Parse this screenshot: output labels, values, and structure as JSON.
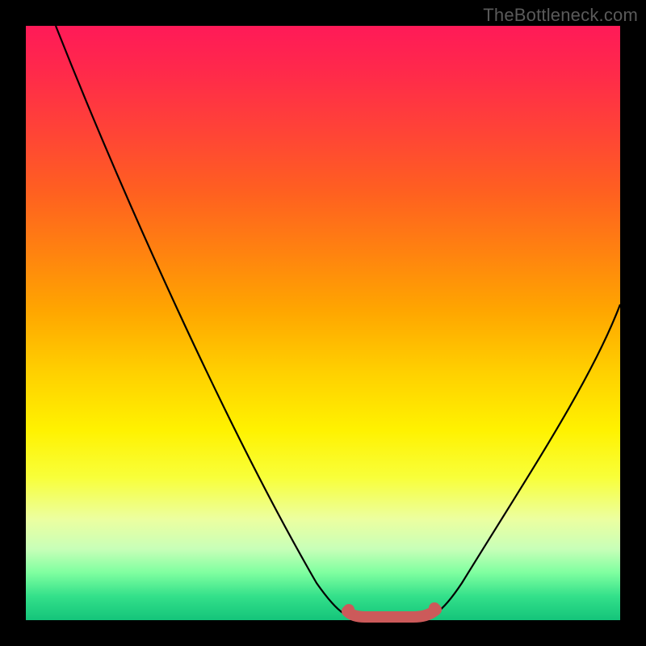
{
  "watermark": {
    "text": "TheBottleneck.com"
  },
  "colors": {
    "frame": "#000000",
    "curve_stroke": "#000000",
    "min_marker": "#cc5a5a"
  },
  "chart_data": {
    "type": "line",
    "title": "",
    "xlabel": "",
    "ylabel": "",
    "xlim": [
      0,
      100
    ],
    "ylim": [
      0,
      100
    ],
    "grid": false,
    "series": [
      {
        "name": "bottleneck-curve",
        "x": [
          5,
          10,
          15,
          20,
          25,
          30,
          35,
          40,
          45,
          50,
          55,
          58,
          60,
          62,
          65,
          70,
          75,
          80,
          85,
          90,
          95,
          100
        ],
        "y": [
          100,
          91,
          82,
          73,
          64,
          55,
          46,
          37,
          28,
          19,
          10,
          4,
          1,
          0,
          0,
          1,
          6,
          14,
          24,
          34,
          44,
          54
        ]
      }
    ],
    "annotations": [
      {
        "name": "minimum-band",
        "x_start": 55,
        "x_end": 68,
        "y": 1
      }
    ]
  }
}
